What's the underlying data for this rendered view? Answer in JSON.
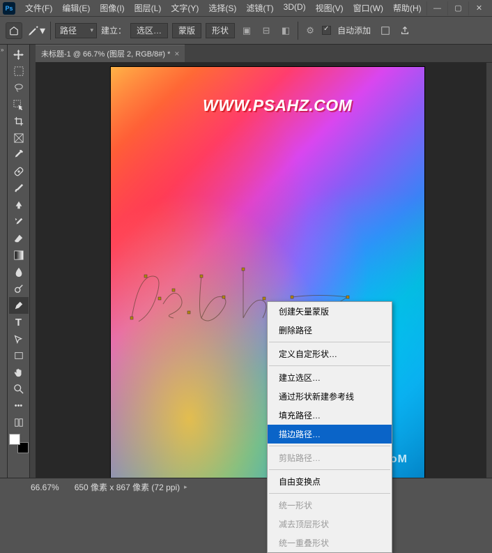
{
  "menubar": [
    "文件(F)",
    "编辑(E)",
    "图像(I)",
    "图层(L)",
    "文字(Y)",
    "选择(S)",
    "滤镜(T)",
    "3D(D)",
    "视图(V)",
    "窗口(W)",
    "帮助(H)"
  ],
  "options": {
    "mode_value": "路径",
    "build_label": "建立：",
    "sel": "选区…",
    "mask": "蒙版",
    "shape": "形状",
    "autoadd": "自动添加"
  },
  "tab": {
    "title": "未标题-1 @ 66.7% (图层 2, RGB/8#) *"
  },
  "canvas": {
    "watermark1": "WWW.PSAHZ.COM",
    "watermark2": "UiBQ.CoM"
  },
  "context_menu": {
    "items": [
      {
        "label": "创建矢量蒙版",
        "state": "normal"
      },
      {
        "label": "删除路径",
        "state": "normal"
      },
      {
        "sep": true
      },
      {
        "label": "定义自定形状…",
        "state": "normal"
      },
      {
        "sep": true
      },
      {
        "label": "建立选区…",
        "state": "normal"
      },
      {
        "label": "通过形状新建参考线",
        "state": "normal"
      },
      {
        "label": "填充路径…",
        "state": "normal"
      },
      {
        "label": "描边路径…",
        "state": "highlighted"
      },
      {
        "sep": true
      },
      {
        "label": "剪贴路径…",
        "state": "disabled"
      },
      {
        "sep": true
      },
      {
        "label": "自由变换点",
        "state": "normal"
      },
      {
        "sep": true
      },
      {
        "label": "统一形状",
        "state": "disabled"
      },
      {
        "label": "减去顶层形状",
        "state": "disabled"
      },
      {
        "label": "统一重叠形状",
        "state": "disabled"
      }
    ]
  },
  "status": {
    "zoom": "66.67%",
    "docinfo": "650 像素 x 867 像素 (72 ppi)"
  }
}
